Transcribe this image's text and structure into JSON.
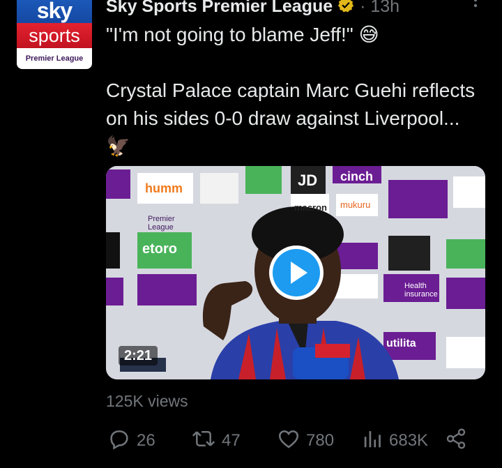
{
  "account": {
    "display_name": "Sky Sports Premier League",
    "separator": "·",
    "time": "13h",
    "avatar": {
      "line1": "sky",
      "line2": "sports",
      "line3": "Premier League"
    }
  },
  "tweet": {
    "text": "\"I'm not going to blame Jeff!\" 😅\n\nCrystal Palace captain Marc Guehi reflects on his sides 0-0 draw against Liverpool... 🦅"
  },
  "video": {
    "duration": "2:21",
    "board_sponsors": [
      "cinch",
      "JD",
      "humm",
      "mukuru",
      "macron",
      "Premier League",
      "etoro",
      "Health insurance",
      "utilita"
    ]
  },
  "stats": {
    "views": "125K views"
  },
  "actions": {
    "replies": "26",
    "reposts": "47",
    "likes": "780",
    "view_count": "683K"
  },
  "colors": {
    "background": "#000000",
    "muted": "#71767b",
    "accent": "#1d9bf0",
    "verified": "#e2b719"
  },
  "icons": [
    "reply-icon",
    "repost-icon",
    "like-icon",
    "views-icon",
    "share-icon",
    "more-icon",
    "verified-badge-icon",
    "play-icon"
  ]
}
